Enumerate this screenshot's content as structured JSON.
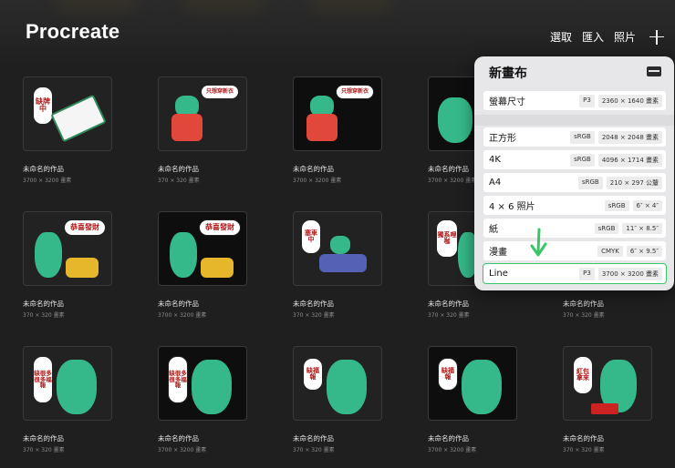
{
  "header": {
    "title": "Procreate",
    "actions": [
      "選取",
      "匯入",
      "照片"
    ],
    "add_icon": "plus-icon"
  },
  "gallery": {
    "items": [
      {
        "title": "未命名的作品",
        "size": "3700 × 3200 畫素",
        "bubble": "缺牌中"
      },
      {
        "title": "未命名的作品",
        "size": "370 × 320 畫素",
        "bubble": "只想穿新衣"
      },
      {
        "title": "未命名的作品",
        "size": "3700 × 3200 畫素",
        "bubble": "只想穿新衣"
      },
      {
        "title": "未命名的作品",
        "size": "3700 × 3200 畫素",
        "bubble": ""
      },
      {
        "title": "未命名的作品",
        "size": "370 × 320 畫素",
        "bubble": "恭喜發財"
      },
      {
        "title": "未命名的作品",
        "size": "3700 × 3200 畫素",
        "bubble": "恭喜發財"
      },
      {
        "title": "未命名的作品",
        "size": "370 × 320 畫素",
        "bubble": "塞車中"
      },
      {
        "title": "未命名的作品",
        "size": "370 × 320 畫素",
        "bubble": "獨系哩咖"
      },
      {
        "title": "未命名的作品",
        "size": "370 × 320 畫素",
        "bubble": ""
      },
      {
        "title": "未命名的作品",
        "size": "370 × 320 畫素",
        "bubble": "缺很多很多福報"
      },
      {
        "title": "未命名的作品",
        "size": "3700 × 3200 畫素",
        "bubble": "缺很多很多福報"
      },
      {
        "title": "未命名的作品",
        "size": "370 × 320 畫素",
        "bubble": "缺福報"
      },
      {
        "title": "未命名的作品",
        "size": "3700 × 3200 畫素",
        "bubble": "缺福報"
      },
      {
        "title": "未命名的作品",
        "size": "370 × 320 畫素",
        "bubble": "紅包拿來"
      }
    ]
  },
  "new_canvas": {
    "title": "新畫布",
    "folder_icon": "new-folder-icon",
    "screen": {
      "name": "螢幕尺寸",
      "color": "P3",
      "dims": "2360 × 1640 畫素"
    },
    "presets": [
      {
        "name": "正方形",
        "color": "sRGB",
        "dims": "2048 × 2048 畫素"
      },
      {
        "name": "4K",
        "color": "sRGB",
        "dims": "4096 × 1714 畫素"
      },
      {
        "name": "A4",
        "color": "sRGB",
        "dims": "210 × 297 公釐"
      },
      {
        "name": "4 × 6 照片",
        "color": "sRGB",
        "dims": "6″ × 4″"
      },
      {
        "name": "紙",
        "color": "sRGB",
        "dims": "11″ × 8.5″"
      },
      {
        "name": "漫畫",
        "color": "CMYK",
        "dims": "6″ × 9.5″"
      },
      {
        "name": "Line",
        "color": "P3",
        "dims": "3700 × 3200 畫素"
      }
    ]
  },
  "colors": {
    "accent_green": "#38c768",
    "dragon": "#35b98a"
  }
}
